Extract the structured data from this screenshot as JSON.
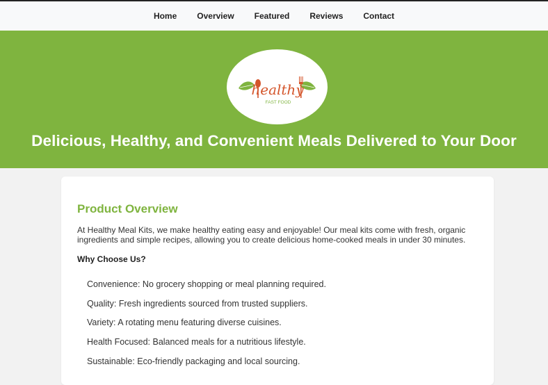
{
  "nav": {
    "items": [
      {
        "label": "Home"
      },
      {
        "label": "Overview"
      },
      {
        "label": "Featured"
      },
      {
        "label": "Reviews"
      },
      {
        "label": "Contact"
      }
    ]
  },
  "hero": {
    "logo": {
      "text": "healthy",
      "subtext": "FAST FOOD"
    },
    "title": "Delicious, Healthy, and Convenient Meals Delivered to Your Door"
  },
  "overview": {
    "heading": "Product Overview",
    "text": "At Healthy Meal Kits, we make healthy eating easy and enjoyable! Our meal kits come with fresh, organic ingredients and simple recipes, allowing you to create delicious home-cooked meals in under 30 minutes.",
    "why_heading": "Why Choose Us?",
    "benefits": [
      "Convenience: No grocery shopping or meal planning required.",
      "Quality: Fresh ingredients sourced from trusted suppliers.",
      "Variety: A rotating menu featuring diverse cuisines.",
      "Health Focused: Balanced meals for a nutritious lifestyle.",
      "Sustainable: Eco-friendly packaging and local sourcing."
    ]
  },
  "colors": {
    "accent": "#7fb43f",
    "logo_text": "#d4552b"
  }
}
